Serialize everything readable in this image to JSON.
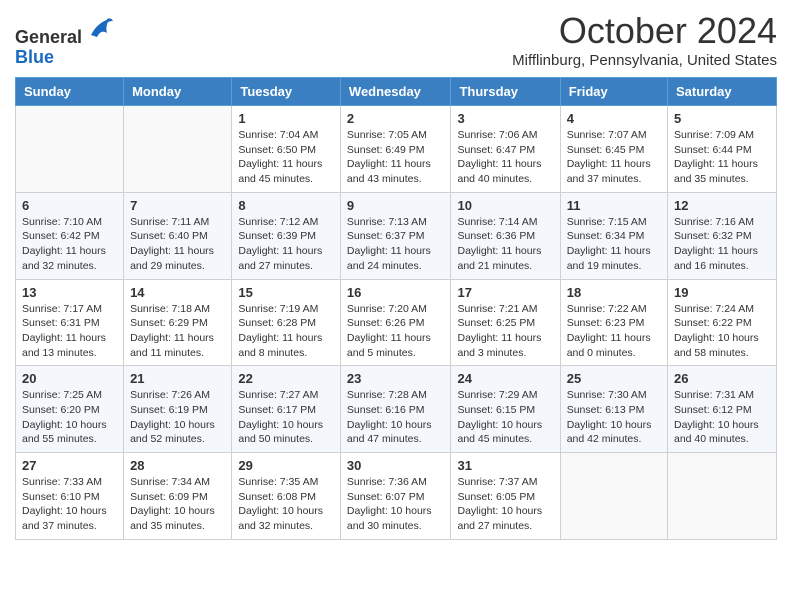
{
  "logo": {
    "general": "General",
    "blue": "Blue"
  },
  "title": "October 2024",
  "location": "Mifflinburg, Pennsylvania, United States",
  "headers": [
    "Sunday",
    "Monday",
    "Tuesday",
    "Wednesday",
    "Thursday",
    "Friday",
    "Saturday"
  ],
  "weeks": [
    [
      {
        "day": "",
        "sunrise": "",
        "sunset": "",
        "daylight": ""
      },
      {
        "day": "",
        "sunrise": "",
        "sunset": "",
        "daylight": ""
      },
      {
        "day": "1",
        "sunrise": "Sunrise: 7:04 AM",
        "sunset": "Sunset: 6:50 PM",
        "daylight": "Daylight: 11 hours and 45 minutes."
      },
      {
        "day": "2",
        "sunrise": "Sunrise: 7:05 AM",
        "sunset": "Sunset: 6:49 PM",
        "daylight": "Daylight: 11 hours and 43 minutes."
      },
      {
        "day": "3",
        "sunrise": "Sunrise: 7:06 AM",
        "sunset": "Sunset: 6:47 PM",
        "daylight": "Daylight: 11 hours and 40 minutes."
      },
      {
        "day": "4",
        "sunrise": "Sunrise: 7:07 AM",
        "sunset": "Sunset: 6:45 PM",
        "daylight": "Daylight: 11 hours and 37 minutes."
      },
      {
        "day": "5",
        "sunrise": "Sunrise: 7:09 AM",
        "sunset": "Sunset: 6:44 PM",
        "daylight": "Daylight: 11 hours and 35 minutes."
      }
    ],
    [
      {
        "day": "6",
        "sunrise": "Sunrise: 7:10 AM",
        "sunset": "Sunset: 6:42 PM",
        "daylight": "Daylight: 11 hours and 32 minutes."
      },
      {
        "day": "7",
        "sunrise": "Sunrise: 7:11 AM",
        "sunset": "Sunset: 6:40 PM",
        "daylight": "Daylight: 11 hours and 29 minutes."
      },
      {
        "day": "8",
        "sunrise": "Sunrise: 7:12 AM",
        "sunset": "Sunset: 6:39 PM",
        "daylight": "Daylight: 11 hours and 27 minutes."
      },
      {
        "day": "9",
        "sunrise": "Sunrise: 7:13 AM",
        "sunset": "Sunset: 6:37 PM",
        "daylight": "Daylight: 11 hours and 24 minutes."
      },
      {
        "day": "10",
        "sunrise": "Sunrise: 7:14 AM",
        "sunset": "Sunset: 6:36 PM",
        "daylight": "Daylight: 11 hours and 21 minutes."
      },
      {
        "day": "11",
        "sunrise": "Sunrise: 7:15 AM",
        "sunset": "Sunset: 6:34 PM",
        "daylight": "Daylight: 11 hours and 19 minutes."
      },
      {
        "day": "12",
        "sunrise": "Sunrise: 7:16 AM",
        "sunset": "Sunset: 6:32 PM",
        "daylight": "Daylight: 11 hours and 16 minutes."
      }
    ],
    [
      {
        "day": "13",
        "sunrise": "Sunrise: 7:17 AM",
        "sunset": "Sunset: 6:31 PM",
        "daylight": "Daylight: 11 hours and 13 minutes."
      },
      {
        "day": "14",
        "sunrise": "Sunrise: 7:18 AM",
        "sunset": "Sunset: 6:29 PM",
        "daylight": "Daylight: 11 hours and 11 minutes."
      },
      {
        "day": "15",
        "sunrise": "Sunrise: 7:19 AM",
        "sunset": "Sunset: 6:28 PM",
        "daylight": "Daylight: 11 hours and 8 minutes."
      },
      {
        "day": "16",
        "sunrise": "Sunrise: 7:20 AM",
        "sunset": "Sunset: 6:26 PM",
        "daylight": "Daylight: 11 hours and 5 minutes."
      },
      {
        "day": "17",
        "sunrise": "Sunrise: 7:21 AM",
        "sunset": "Sunset: 6:25 PM",
        "daylight": "Daylight: 11 hours and 3 minutes."
      },
      {
        "day": "18",
        "sunrise": "Sunrise: 7:22 AM",
        "sunset": "Sunset: 6:23 PM",
        "daylight": "Daylight: 11 hours and 0 minutes."
      },
      {
        "day": "19",
        "sunrise": "Sunrise: 7:24 AM",
        "sunset": "Sunset: 6:22 PM",
        "daylight": "Daylight: 10 hours and 58 minutes."
      }
    ],
    [
      {
        "day": "20",
        "sunrise": "Sunrise: 7:25 AM",
        "sunset": "Sunset: 6:20 PM",
        "daylight": "Daylight: 10 hours and 55 minutes."
      },
      {
        "day": "21",
        "sunrise": "Sunrise: 7:26 AM",
        "sunset": "Sunset: 6:19 PM",
        "daylight": "Daylight: 10 hours and 52 minutes."
      },
      {
        "day": "22",
        "sunrise": "Sunrise: 7:27 AM",
        "sunset": "Sunset: 6:17 PM",
        "daylight": "Daylight: 10 hours and 50 minutes."
      },
      {
        "day": "23",
        "sunrise": "Sunrise: 7:28 AM",
        "sunset": "Sunset: 6:16 PM",
        "daylight": "Daylight: 10 hours and 47 minutes."
      },
      {
        "day": "24",
        "sunrise": "Sunrise: 7:29 AM",
        "sunset": "Sunset: 6:15 PM",
        "daylight": "Daylight: 10 hours and 45 minutes."
      },
      {
        "day": "25",
        "sunrise": "Sunrise: 7:30 AM",
        "sunset": "Sunset: 6:13 PM",
        "daylight": "Daylight: 10 hours and 42 minutes."
      },
      {
        "day": "26",
        "sunrise": "Sunrise: 7:31 AM",
        "sunset": "Sunset: 6:12 PM",
        "daylight": "Daylight: 10 hours and 40 minutes."
      }
    ],
    [
      {
        "day": "27",
        "sunrise": "Sunrise: 7:33 AM",
        "sunset": "Sunset: 6:10 PM",
        "daylight": "Daylight: 10 hours and 37 minutes."
      },
      {
        "day": "28",
        "sunrise": "Sunrise: 7:34 AM",
        "sunset": "Sunset: 6:09 PM",
        "daylight": "Daylight: 10 hours and 35 minutes."
      },
      {
        "day": "29",
        "sunrise": "Sunrise: 7:35 AM",
        "sunset": "Sunset: 6:08 PM",
        "daylight": "Daylight: 10 hours and 32 minutes."
      },
      {
        "day": "30",
        "sunrise": "Sunrise: 7:36 AM",
        "sunset": "Sunset: 6:07 PM",
        "daylight": "Daylight: 10 hours and 30 minutes."
      },
      {
        "day": "31",
        "sunrise": "Sunrise: 7:37 AM",
        "sunset": "Sunset: 6:05 PM",
        "daylight": "Daylight: 10 hours and 27 minutes."
      },
      {
        "day": "",
        "sunrise": "",
        "sunset": "",
        "daylight": ""
      },
      {
        "day": "",
        "sunrise": "",
        "sunset": "",
        "daylight": ""
      }
    ]
  ]
}
